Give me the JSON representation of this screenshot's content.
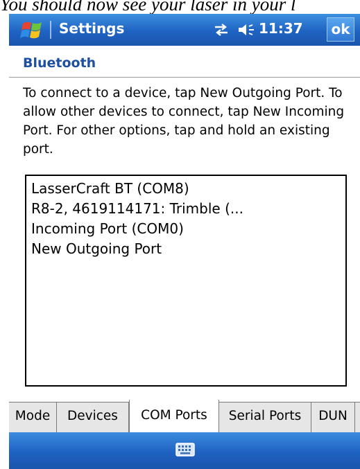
{
  "caption": "You should now see your laser in your l",
  "titlebar": {
    "start_icon": "windows-flag-icon",
    "title": "Settings",
    "connectivity_icon": "connectivity-arrows-icon",
    "volume_icon": "speaker-volume-icon",
    "time": "11:37",
    "ok_label": "ok"
  },
  "page": {
    "title": "Bluetooth",
    "instructions": "To connect to a device, tap New Outgoing Port. To allow other devices to connect, tap New Incoming Port. For other options, tap and hold an existing port."
  },
  "ports": [
    "LasserCraft BT (COM8)",
    "R8-2, 4619114171: Trimble (...",
    "Incoming Port (COM0)",
    "New Outgoing Port"
  ],
  "tabs": [
    {
      "label": "Mode",
      "active": false
    },
    {
      "label": "Devices",
      "active": false
    },
    {
      "label": "COM Ports",
      "active": true
    },
    {
      "label": "Serial Ports",
      "active": false
    },
    {
      "label": "DUN",
      "active": false
    }
  ],
  "softbar": {
    "keyboard_icon": "keyboard-icon"
  },
  "colors": {
    "titlebar_blue": "#1f63c2",
    "heading_blue": "#1d4fa3",
    "tab_background": "#e6e6e6"
  }
}
